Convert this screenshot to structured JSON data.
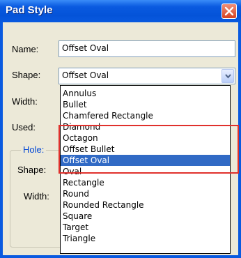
{
  "window": {
    "title": "Pad Style"
  },
  "form": {
    "name_label": "Name:",
    "name_value": "Offset Oval",
    "shape_label": "Shape:",
    "shape_value": "Offset Oval",
    "width_label": "Width:",
    "used_label": "Used:",
    "hole_group_label": "Hole:",
    "hole_shape_label": "Shape:",
    "hole_width_label": "Width:"
  },
  "shape_dropdown": {
    "options": [
      "Annulus",
      "Bullet",
      "Chamfered Rectangle",
      "Diamond",
      "Octagon",
      "Offset Bullet",
      "Offset Oval",
      "Oval",
      "Rectangle",
      "Round",
      "Rounded Rectangle",
      "Square",
      "Target",
      "Triangle"
    ],
    "selected": "Offset Oval"
  },
  "colors": {
    "titlebar": "#0a5ae0",
    "selection": "#316ac5",
    "highlight_annotation": "#e0312c",
    "group_label": "#0046d5"
  },
  "icons": {
    "close": "close-icon",
    "combo_arrow": "chevron-down-icon"
  }
}
